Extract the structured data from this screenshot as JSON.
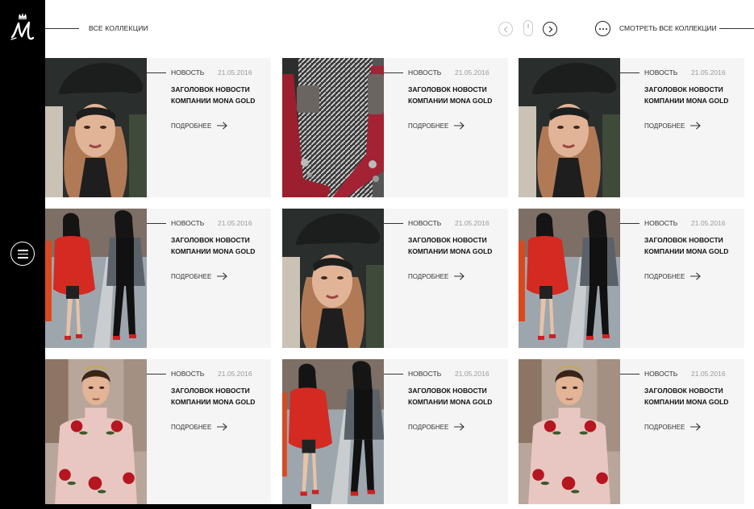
{
  "header": {
    "all_collections": "ВСЕ КОЛЛЕКЦИИ",
    "view_all": "СМОТРЕТЬ ВСЕ КОЛЛЕКЦИИ"
  },
  "icons": {
    "logo": "mona-gold-crown-logo",
    "menu": "hamburger-icon",
    "prev": "arrow-left-icon",
    "next": "arrow-right-icon",
    "more": "more-dots-icon"
  },
  "colors": {
    "sidebar": "#000000",
    "card_bg": "#f5f5f5",
    "date": "#9a9a9a"
  },
  "news": [
    {
      "category": "НОВОСТЬ",
      "date": "21.05.2016",
      "title": "ЗАГОЛОВОК НОВОСТИ КОМПАНИИ MONA GOLD",
      "more": "ПОДРОБНЕЕ",
      "image": "woman-in-black-hat"
    },
    {
      "category": "НОВОСТЬ",
      "date": "21.05.2016",
      "title": "ЗАГОЛОВОК НОВОСТИ КОМПАНИИ MONA GOLD",
      "more": "ПОДРОБНЕЕ",
      "image": "red-gloves-tweed-coat"
    },
    {
      "category": "НОВОСТЬ",
      "date": "21.05.2016",
      "title": "ЗАГОЛОВОК НОВОСТИ КОМПАНИИ MONA GOLD",
      "more": "ПОДРОБНЕЕ",
      "image": "woman-in-black-hat"
    },
    {
      "category": "НОВОСТЬ",
      "date": "21.05.2016",
      "title": "ЗАГОЛОВОК НОВОСТИ КОМПАНИИ MONA GOLD",
      "more": "ПОДРОБНЕЕ",
      "image": "street-style-red-coat"
    },
    {
      "category": "НОВОСТЬ",
      "date": "21.05.2016",
      "title": "ЗАГОЛОВОК НОВОСТИ КОМПАНИИ MONA GOLD",
      "more": "ПОДРОБНЕЕ",
      "image": "woman-in-black-hat"
    },
    {
      "category": "НОВОСТЬ",
      "date": "21.05.2016",
      "title": "ЗАГОЛОВОК НОВОСТИ КОМПАНИИ MONA GOLD",
      "more": "ПОДРОБНЕЕ",
      "image": "street-style-red-coat"
    },
    {
      "category": "НОВОСТЬ",
      "date": "21.05.2016",
      "title": "ЗАГОЛОВОК НОВОСТИ КОМПАНИИ MONA GOLD",
      "more": "ПОДРОБНЕЕ",
      "image": "model-pink-rose-dress"
    },
    {
      "category": "НОВОСТЬ",
      "date": "21.05.2016",
      "title": "ЗАГОЛОВОК НОВОСТИ КОМПАНИИ MONA GOLD",
      "more": "ПОДРОБНЕЕ",
      "image": "street-style-red-coat"
    },
    {
      "category": "НОВОСТЬ",
      "date": "21.05.2016",
      "title": "ЗАГОЛОВОК НОВОСТИ КОМПАНИИ MONA GOLD",
      "more": "ПОДРОБНЕЕ",
      "image": "model-pink-rose-dress"
    }
  ]
}
